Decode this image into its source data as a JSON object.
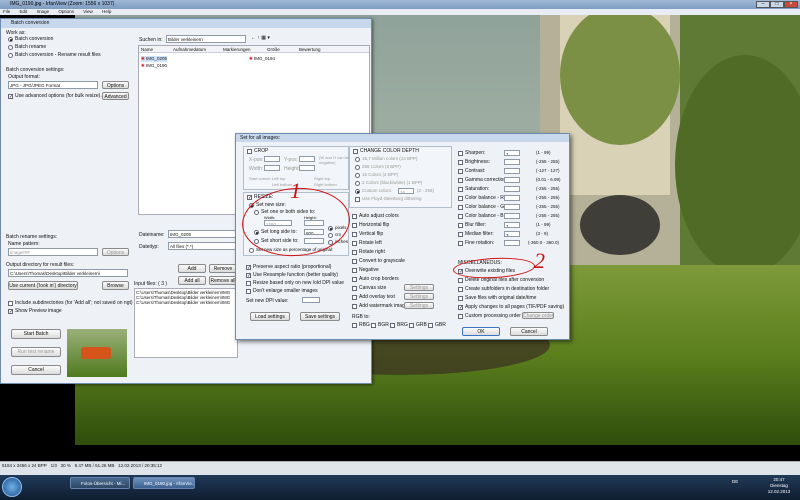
{
  "window": {
    "title": "IMG_0190.jpg - IrfanView (Zoom: 1556 x 1037)",
    "menu": [
      "File",
      "Edit",
      "Image",
      "Options",
      "View",
      "Help"
    ]
  },
  "status": {
    "left": "5184 x 3456 x 24 BPP",
    "page": "1/3",
    "zoom": "30 %",
    "size": "8.47 MB / 51.26 MB",
    "date": "12.02.2013 / 20:35:12"
  },
  "taskbar": {
    "items": [
      "Fotos-Übersicht - Mi...",
      "IMG_0190.jpg - IrfanVie..."
    ],
    "lang": "DE",
    "time": "20:47",
    "day": "Dienstag",
    "date": "12.02.2013"
  },
  "batch": {
    "title": "Batch conversion",
    "work_as": "Work as:",
    "modes": [
      "Batch conversion",
      "Batch rename",
      "Batch conversion - Rename result files"
    ],
    "settings_title": "Batch conversion settings:",
    "output_format_label": "Output format:",
    "output_format": "JPG - JPG/JPEG Format",
    "options": "Options",
    "use_advanced": "Use advanced options (for bulk resize)...",
    "advanced": "Advanced",
    "rename_title": "Batch rename settings:",
    "name_pattern_label": "Name pattern:",
    "name_pattern": "image###",
    "options2": "Options",
    "output_dir_label": "Output directory for result files:",
    "output_dir": "C:\\Users\\Thomas\\Desktop\\Bilder verkleinern\\",
    "use_current": "Use current ('look in') directory",
    "browse": "Browse",
    "include_sub": "Include subdirectories (for 'Add all'; not saved on ngt)",
    "show_preview": "Show Preview image",
    "start": "Start Batch",
    "test_rename": "Run test rename",
    "cancel": "Cancel",
    "search_label": "Suchen in:",
    "search_value": "Bilder verkleinern",
    "columns": [
      "Name",
      "Aufnahmedatum",
      "Markierungen",
      "Größe",
      "Bewertung"
    ],
    "files": [
      "IMG_0205",
      "IMG_0190",
      "IMG_0194"
    ],
    "dateiname_label": "Dateiname:",
    "dateiname": "IMG_0205",
    "dateityp_label": "Dateityp:",
    "dateityp": "All files (*.*)",
    "add": "Add",
    "remove": "Remove",
    "add_all": "Add all",
    "remove_all": "Remove all",
    "input_files": "Input files: ( 3 )",
    "input_list": [
      "C:\\Users\\Thomas\\Desktop\\Bilder verkleinern\\IMG",
      "C:\\Users\\Thomas\\Desktop\\Bilder verkleinern\\IMG",
      "C:\\Users\\Thomas\\Desktop\\Bilder verkleinern\\IMG"
    ]
  },
  "settings": {
    "title": "Set for all images:",
    "crop": "CROP",
    "xpos": "X-pos:",
    "ypos": "Y-pos:",
    "width": "Width:",
    "height": "Height:",
    "crop_note": "(W and H can be negative)",
    "start_corner": "Start corner:",
    "corners": [
      "Left top",
      "Right top",
      "Left bottom",
      "Right bottom",
      "Center"
    ],
    "resize": "RESIZE:",
    "set_new_size": "Set new size:",
    "one_or_both": "Set one or both sides to:",
    "w_val": "1280",
    "h_val": "",
    "long_side": "Set long side to:",
    "long_val": "800",
    "short_side": "Set short side to:",
    "units": [
      "pixels",
      "cm",
      "inches"
    ],
    "percentage": "Set new size as percentage of original:",
    "preserve": "Preserve aspect ratio (proportional)",
    "resample": "Use Resample function (better quality)",
    "dpi_only": "Resize based only on new /old DPI value",
    "dont_enlarge": "Don't enlarge smaller images",
    "new_dpi": "Set new DPI value:",
    "load": "Load settings",
    "save": "Save settings",
    "color_depth": "CHANGE COLOR DEPTH",
    "depths": [
      "16,7 Million colors (24 BPP)",
      "256 Colors (8 BPP)",
      "16 Colors (4 BPP)",
      "2 Colors (black/white) (1 BPP)",
      "Custom colors:",
      "Use Floyd-Steinberg dithering"
    ],
    "custom_range": "(2 - 256)",
    "custom_val": "16",
    "ops": [
      "Auto adjust colors",
      "Horizontal flip",
      "Vertical flip",
      "Rotate left",
      "Rotate right",
      "Convert to grayscale",
      "Negative",
      "Auto crop borders",
      "Canvas size",
      "Add overlay text",
      "Add watermark image"
    ],
    "settings_btn": "Settings",
    "rgb_label": "RGB to:",
    "rgb": [
      "RBG",
      "BGR",
      "BRG",
      "GRB",
      "GBR"
    ],
    "adjust": [
      {
        "label": "Sharpen:",
        "val": "1",
        "range": "(1 - 99)"
      },
      {
        "label": "Brightness:",
        "val": "",
        "range": "(-255 - 255)"
      },
      {
        "label": "Contrast:",
        "val": "",
        "range": "(-127 - 127)"
      },
      {
        "label": "Gamma correction:",
        "val": "",
        "range": "(0.01 - 6.99)"
      },
      {
        "label": "Saturation:",
        "val": "",
        "range": "(-255 - 255)"
      },
      {
        "label": "Color balance - R:",
        "val": "",
        "range": "(-255 - 255)"
      },
      {
        "label": "Color balance - G:",
        "val": "",
        "range": "(-255 - 255)"
      },
      {
        "label": "Color balance - B:",
        "val": "",
        "range": "(-255 - 255)"
      },
      {
        "label": "Blur filter:",
        "val": "1",
        "range": "(1 - 99)"
      },
      {
        "label": "Median filter:",
        "val": "3",
        "range": "(3 - 9)"
      },
      {
        "label": "Fine rotation:",
        "val": "",
        "range": "(-360.0 - 360.0)"
      }
    ],
    "misc": "MISCELLANEOUS:",
    "misc_items": [
      "Overwrite existing files",
      "Delete original files after conversion",
      "Create subfolders in destination folder",
      "Save files with original date/time",
      "Apply changes to all pages (TIF/PDF saving)",
      "Custom processing order"
    ],
    "change_order": "Change order",
    "ok": "OK",
    "cancel": "Cancel"
  },
  "annotations": [
    "1",
    "2"
  ]
}
